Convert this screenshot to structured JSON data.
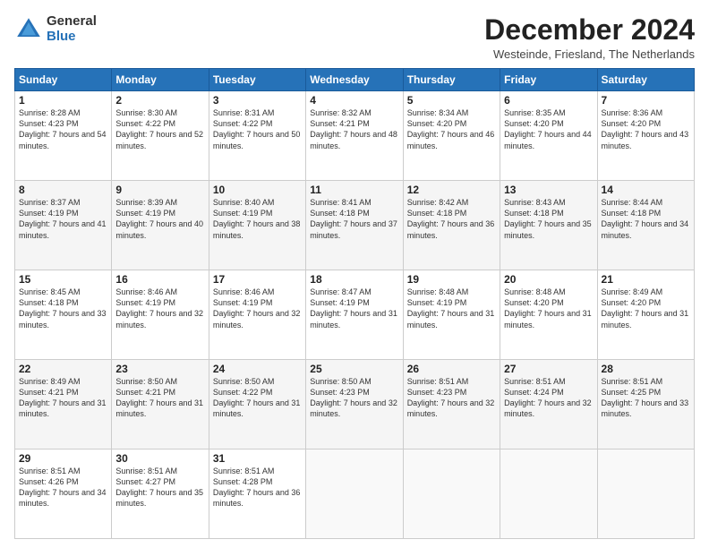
{
  "logo": {
    "line1": "General",
    "line2": "Blue"
  },
  "title": "December 2024",
  "location": "Westeinde, Friesland, The Netherlands",
  "days_of_week": [
    "Sunday",
    "Monday",
    "Tuesday",
    "Wednesday",
    "Thursday",
    "Friday",
    "Saturday"
  ],
  "weeks": [
    [
      {
        "day": "1",
        "sunrise": "8:28 AM",
        "sunset": "4:23 PM",
        "daylight": "7 hours and 54 minutes."
      },
      {
        "day": "2",
        "sunrise": "8:30 AM",
        "sunset": "4:22 PM",
        "daylight": "7 hours and 52 minutes."
      },
      {
        "day": "3",
        "sunrise": "8:31 AM",
        "sunset": "4:22 PM",
        "daylight": "7 hours and 50 minutes."
      },
      {
        "day": "4",
        "sunrise": "8:32 AM",
        "sunset": "4:21 PM",
        "daylight": "7 hours and 48 minutes."
      },
      {
        "day": "5",
        "sunrise": "8:34 AM",
        "sunset": "4:20 PM",
        "daylight": "7 hours and 46 minutes."
      },
      {
        "day": "6",
        "sunrise": "8:35 AM",
        "sunset": "4:20 PM",
        "daylight": "7 hours and 44 minutes."
      },
      {
        "day": "7",
        "sunrise": "8:36 AM",
        "sunset": "4:20 PM",
        "daylight": "7 hours and 43 minutes."
      }
    ],
    [
      {
        "day": "8",
        "sunrise": "8:37 AM",
        "sunset": "4:19 PM",
        "daylight": "7 hours and 41 minutes."
      },
      {
        "day": "9",
        "sunrise": "8:39 AM",
        "sunset": "4:19 PM",
        "daylight": "7 hours and 40 minutes."
      },
      {
        "day": "10",
        "sunrise": "8:40 AM",
        "sunset": "4:19 PM",
        "daylight": "7 hours and 38 minutes."
      },
      {
        "day": "11",
        "sunrise": "8:41 AM",
        "sunset": "4:18 PM",
        "daylight": "7 hours and 37 minutes."
      },
      {
        "day": "12",
        "sunrise": "8:42 AM",
        "sunset": "4:18 PM",
        "daylight": "7 hours and 36 minutes."
      },
      {
        "day": "13",
        "sunrise": "8:43 AM",
        "sunset": "4:18 PM",
        "daylight": "7 hours and 35 minutes."
      },
      {
        "day": "14",
        "sunrise": "8:44 AM",
        "sunset": "4:18 PM",
        "daylight": "7 hours and 34 minutes."
      }
    ],
    [
      {
        "day": "15",
        "sunrise": "8:45 AM",
        "sunset": "4:18 PM",
        "daylight": "7 hours and 33 minutes."
      },
      {
        "day": "16",
        "sunrise": "8:46 AM",
        "sunset": "4:19 PM",
        "daylight": "7 hours and 32 minutes."
      },
      {
        "day": "17",
        "sunrise": "8:46 AM",
        "sunset": "4:19 PM",
        "daylight": "7 hours and 32 minutes."
      },
      {
        "day": "18",
        "sunrise": "8:47 AM",
        "sunset": "4:19 PM",
        "daylight": "7 hours and 31 minutes."
      },
      {
        "day": "19",
        "sunrise": "8:48 AM",
        "sunset": "4:19 PM",
        "daylight": "7 hours and 31 minutes."
      },
      {
        "day": "20",
        "sunrise": "8:48 AM",
        "sunset": "4:20 PM",
        "daylight": "7 hours and 31 minutes."
      },
      {
        "day": "21",
        "sunrise": "8:49 AM",
        "sunset": "4:20 PM",
        "daylight": "7 hours and 31 minutes."
      }
    ],
    [
      {
        "day": "22",
        "sunrise": "8:49 AM",
        "sunset": "4:21 PM",
        "daylight": "7 hours and 31 minutes."
      },
      {
        "day": "23",
        "sunrise": "8:50 AM",
        "sunset": "4:21 PM",
        "daylight": "7 hours and 31 minutes."
      },
      {
        "day": "24",
        "sunrise": "8:50 AM",
        "sunset": "4:22 PM",
        "daylight": "7 hours and 31 minutes."
      },
      {
        "day": "25",
        "sunrise": "8:50 AM",
        "sunset": "4:23 PM",
        "daylight": "7 hours and 32 minutes."
      },
      {
        "day": "26",
        "sunrise": "8:51 AM",
        "sunset": "4:23 PM",
        "daylight": "7 hours and 32 minutes."
      },
      {
        "day": "27",
        "sunrise": "8:51 AM",
        "sunset": "4:24 PM",
        "daylight": "7 hours and 32 minutes."
      },
      {
        "day": "28",
        "sunrise": "8:51 AM",
        "sunset": "4:25 PM",
        "daylight": "7 hours and 33 minutes."
      }
    ],
    [
      {
        "day": "29",
        "sunrise": "8:51 AM",
        "sunset": "4:26 PM",
        "daylight": "7 hours and 34 minutes."
      },
      {
        "day": "30",
        "sunrise": "8:51 AM",
        "sunset": "4:27 PM",
        "daylight": "7 hours and 35 minutes."
      },
      {
        "day": "31",
        "sunrise": "8:51 AM",
        "sunset": "4:28 PM",
        "daylight": "7 hours and 36 minutes."
      },
      null,
      null,
      null,
      null
    ]
  ]
}
